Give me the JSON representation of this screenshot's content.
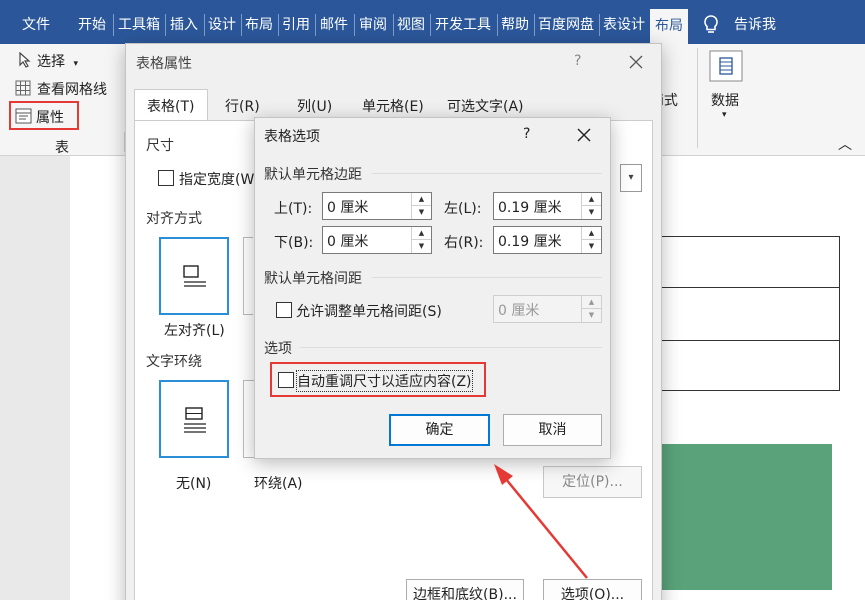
{
  "ribbon_tabs": [
    "文件",
    "开始",
    "工具箱",
    "插入",
    "设计",
    "布局",
    "引用",
    "邮件",
    "审阅",
    "视图",
    "开发工具",
    "帮助",
    "百度网盘",
    "表设计",
    "布局"
  ],
  "tell_me": "告诉我",
  "ribbon": {
    "select": "选择",
    "gridlines": "查看网格线",
    "properties": "属性",
    "group_table": "表",
    "data": "数据",
    "partial_text": "i式"
  },
  "table_props": {
    "title": "表格属性",
    "help": "?",
    "tabs": [
      "表格(T)",
      "行(R)",
      "列(U)",
      "单元格(E)",
      "可选文字(A)"
    ],
    "size_label": "尺寸",
    "specify_width": "指定宽度(W",
    "alignment_label": "对齐方式",
    "align_left": "左对齐(L)",
    "wrap_label": "文字环绕",
    "wrap_none": "无(N)",
    "wrap_around": "环绕(A)",
    "position_button": "定位(P)...",
    "borders_button": "边框和底纹(B)...",
    "options_button": "选项(O)..."
  },
  "table_options": {
    "title": "表格选项",
    "help": "?",
    "margins_label": "默认单元格边距",
    "top_label": "上(T):",
    "top_value": "0 厘米",
    "left_label": "左(L):",
    "left_value": "0.19 厘米",
    "bottom_label": "下(B):",
    "bottom_value": "0 厘米",
    "right_label": "右(R):",
    "right_value": "0.19 厘米",
    "spacing_label": "默认单元格间距",
    "allow_spacing": "允许调整单元格间距(S)",
    "spacing_value": "0 厘米",
    "options_label": "选项",
    "autofit": "自动重调尺寸以适应内容(Z)",
    "ok": "确定",
    "cancel": "取消"
  },
  "colors": {
    "ribbon_blue": "#2b579a",
    "highlight_red": "#e53935",
    "doc_green": "#5aa37a",
    "focus_blue": "#0078d4"
  }
}
